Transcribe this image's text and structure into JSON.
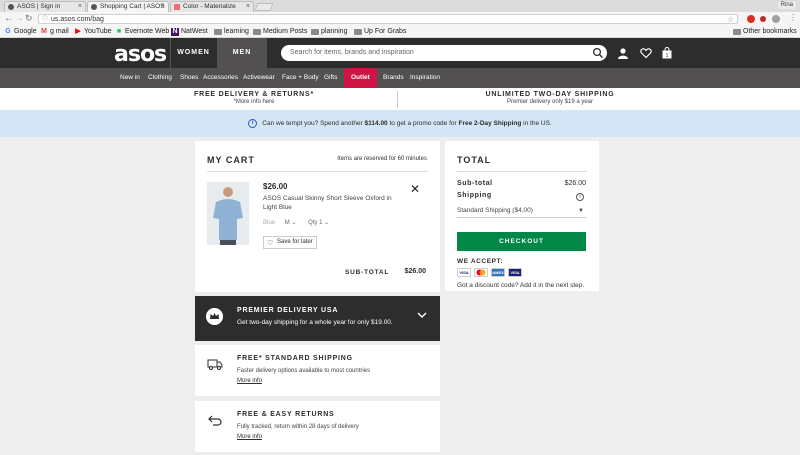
{
  "browser": {
    "tabs": [
      {
        "label": "ASOS | Sign in"
      },
      {
        "label": "Shopping Cart | ASOS"
      },
      {
        "label": "Color - Materialize"
      }
    ],
    "user": "Rina",
    "url": "us.asos.com/bag",
    "bookmarks": [
      {
        "label": "Google",
        "icon": "G",
        "color": "#4285f4"
      },
      {
        "label": "g mail",
        "icon": "M",
        "color": "#d44638"
      },
      {
        "label": "YouTube",
        "icon": "▶",
        "color": "#ff0000"
      },
      {
        "label": "Evernote Web",
        "icon": "■",
        "color": "#2dbe60"
      },
      {
        "label": "NatWest",
        "icon": "N",
        "color": "#42145f"
      },
      {
        "label": "learning",
        "icon": "folder"
      },
      {
        "label": "Medium Posts",
        "icon": "folder"
      },
      {
        "label": "planning",
        "icon": "folder"
      },
      {
        "label": "Up For Grabs",
        "icon": "folder"
      }
    ],
    "other_bookmarks": "Other bookmarks"
  },
  "header": {
    "logo": "asos",
    "women": "WOMEN",
    "men": "MEN",
    "search_placeholder": "Search for items, brands and inspiration"
  },
  "categories": [
    "New in",
    "Clothing",
    "Shoes",
    "Accessories",
    "Activewear",
    "Face + Body",
    "Gifts",
    "Outlet",
    "Brands",
    "Inspiration"
  ],
  "promo": {
    "left_title": "FREE DELIVERY & RETURNS*",
    "left_sub": "*More info here",
    "right_title": "UNLIMITED TWO-DAY SHIPPING",
    "right_sub": "Premier delivery only $19 a year"
  },
  "banner": {
    "pre": "Can we tempt you? Spend another ",
    "amount": "$114.00",
    "mid": " to get a promo code for ",
    "bold": "Free 2-Day Shipping",
    "post": " in the US."
  },
  "cart": {
    "title": "MY CART",
    "note": "Items are reserved for 60 minutes",
    "item": {
      "price": "$26.00",
      "name": "ASOS Casual Skinny Short Sleeve Oxford in Light Blue",
      "color": "Blue",
      "size": "M",
      "qty_label": "Qty",
      "qty": "1",
      "save_label": "Save for later"
    },
    "subtotal_label": "SUB-TOTAL",
    "subtotal_value": "$26.00"
  },
  "premier": {
    "title": "PREMIER DELIVERY USA",
    "desc": "Get two-day shipping for a whole year for only $19.00."
  },
  "features": [
    {
      "title": "FREE* STANDARD SHIPPING",
      "desc": "Faster delivery options available to most countries",
      "link": "More info"
    },
    {
      "title": "FREE & EASY RETURNS",
      "desc": "Fully tracked, return within 28 days of delivery",
      "link": "More info"
    }
  ],
  "total": {
    "title": "TOTAL",
    "subtotal_label": "Sub-total",
    "subtotal_value": "$26.00",
    "shipping_label": "Shipping",
    "shipping_option": "Standard Shipping ($4.00)",
    "checkout": "CHECKOUT",
    "accept": "WE ACCEPT:",
    "cards": [
      "VISA",
      "MC",
      "AMEX",
      "VISA"
    ],
    "discount": "Got a discount code? Add it in the next step."
  },
  "colors": {
    "header_bg": "#2d2d2d",
    "nav_bg": "#525050",
    "outlet": "#d01345",
    "banner_bg": "#d4e6f5",
    "checkout": "#018849"
  }
}
